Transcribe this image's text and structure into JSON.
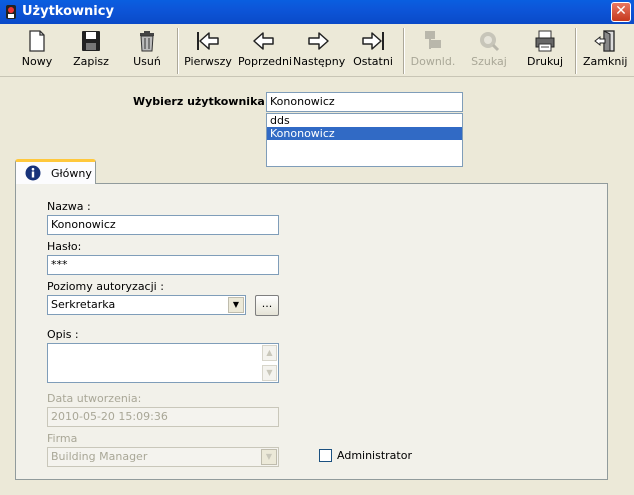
{
  "window": {
    "title": "Użytkownicy"
  },
  "toolbar": {
    "buttons": [
      {
        "label": "Nowy",
        "icon": "new-document-icon",
        "enabled": true
      },
      {
        "label": "Zapisz",
        "icon": "floppy-disk-icon",
        "enabled": true
      },
      {
        "label": "Usuń",
        "icon": "trash-can-icon",
        "enabled": true
      },
      {
        "label": "Pierwszy",
        "icon": "first-arrow-icon",
        "enabled": true
      },
      {
        "label": "Poprzedni",
        "icon": "previous-arrow-icon",
        "enabled": true
      },
      {
        "label": "Następny",
        "icon": "next-arrow-icon",
        "enabled": true
      },
      {
        "label": "Ostatni",
        "icon": "last-arrow-icon",
        "enabled": true
      },
      {
        "label": "Downld.",
        "icon": "download-icon",
        "enabled": false
      },
      {
        "label": "Szukaj",
        "icon": "search-icon",
        "enabled": false
      },
      {
        "label": "Drukuj",
        "icon": "printer-icon",
        "enabled": true
      },
      {
        "label": "Zamknij",
        "icon": "exit-door-icon",
        "enabled": true
      }
    ]
  },
  "picker": {
    "label": "Wybierz użytkownika :",
    "value": "Kononowicz",
    "items": [
      "dds",
      "Kononowicz"
    ],
    "selected": "Kononowicz"
  },
  "tab": {
    "label": "Główny",
    "icon": "info-icon"
  },
  "form": {
    "name_label": "Nazwa :",
    "name_value": "Kononowicz",
    "password_label": "Hasło:",
    "password_value": "***",
    "auth_label": "Poziomy autoryzacji :",
    "auth_value": "Serkretarka",
    "auth_more_label": "...",
    "desc_label": "Opis :",
    "created_label": "Data utworzenia:",
    "created_value": "2010-05-20 15:09:36",
    "company_label": "Firma",
    "company_value": "Building Manager",
    "admin_label": "Administrator",
    "admin_checked": false
  },
  "colors": {
    "titlebar": "#0a4ac8",
    "selection": "#316ac5",
    "window_bg": "#ece9d8",
    "tab_accent": "#ffc83c"
  }
}
